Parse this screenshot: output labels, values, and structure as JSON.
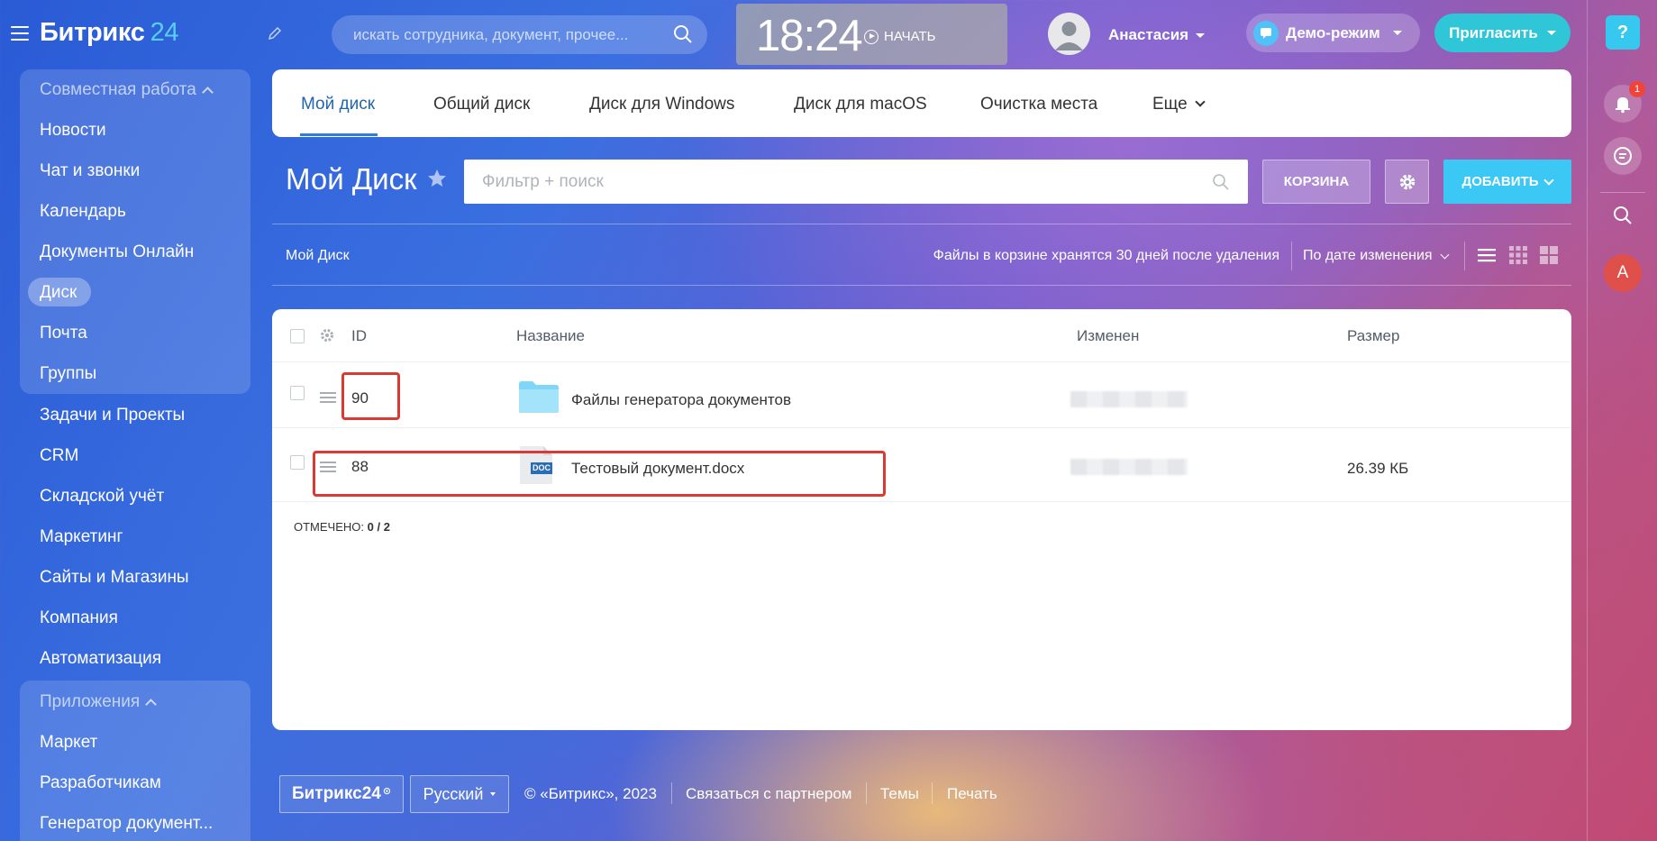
{
  "header": {
    "logo_main": "Битрикс",
    "logo_num": "24",
    "search_placeholder": "искать сотрудника, документ, прочее...",
    "time": "18:24",
    "start_label": "НАЧАТЬ",
    "user_name": "Анастасия",
    "demo_label": "Демо-режим",
    "invite_label": "Пригласить"
  },
  "rail": {
    "help": "?",
    "notif_count": "1",
    "user_initial": "A"
  },
  "sidebar": {
    "group1_title": "Совместная работа",
    "group1_items": [
      "Новости",
      "Чат и звонки",
      "Календарь",
      "Документы Онлайн",
      "Диск",
      "Почта",
      "Группы"
    ],
    "items": [
      "Задачи и Проекты",
      "CRM",
      "Складской учёт",
      "Маркетинг",
      "Сайты и Магазины",
      "Компания",
      "Автоматизация"
    ],
    "group2_title": "Приложения",
    "group2_items": [
      "Маркет",
      "Разработчикам",
      "Генератор документ..."
    ]
  },
  "tabs": [
    "Мой диск",
    "Общий диск",
    "Диск для Windows",
    "Диск для macOS",
    "Очистка места",
    "Еще"
  ],
  "toolbar": {
    "title": "Мой Диск",
    "filter_placeholder": "Фильтр + поиск",
    "trash_label": "КОРЗИНА",
    "add_label": "ДОБАВИТЬ"
  },
  "subbar": {
    "breadcrumb": "Мой Диск",
    "trash_note": "Файлы в корзине хранятся 30 дней после удаления",
    "sort_label": "По дате изменения"
  },
  "table": {
    "headers": {
      "id": "ID",
      "name": "Название",
      "modified": "Изменен",
      "size": "Размер"
    },
    "rows": [
      {
        "id": "90",
        "name": "Файлы генератора документов",
        "type": "folder",
        "size": ""
      },
      {
        "id": "88",
        "name": "Тестовый документ.docx",
        "type": "doc",
        "size": "26.39 КБ"
      }
    ],
    "counter_label": "ОТМЕЧЕНО:",
    "counter_value": "0 / 2",
    "doc_badge": "DOC"
  },
  "footer": {
    "logo": "Битрикс24",
    "lang": "Русский",
    "copyright": "© «Битрикс», 2023",
    "partner": "Связаться с партнером",
    "themes": "Темы",
    "print": "Печать"
  },
  "colors": {
    "accent": "#3bc8f5",
    "highlight": "#d93a33",
    "tab_active": "#2066b0"
  }
}
